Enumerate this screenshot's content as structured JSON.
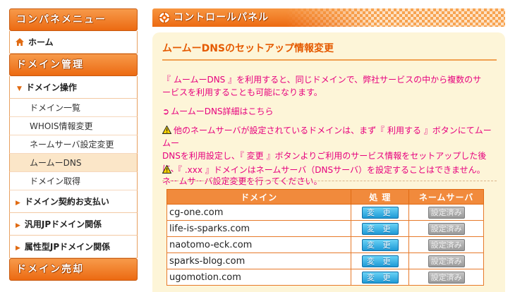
{
  "sidebar": {
    "menu_title": "コンパネメニュー",
    "home_label": "ホーム",
    "domain_mgmt_title": "ドメイン管理",
    "domain_ops_label": "ドメイン操作",
    "sub_items": [
      {
        "label": "ドメイン一覧"
      },
      {
        "label": "WHOIS情報変更"
      },
      {
        "label": "ネームサーバ設定変更"
      },
      {
        "label": "ムームーDNS"
      },
      {
        "label": "ドメイン取得"
      }
    ],
    "contract_label": "ドメイン契約お支払い",
    "jp_label": "汎用JPドメイン関係",
    "attr_jp_label": "属性型JPドメイン関係",
    "domain_sale_title": "ドメイン売却"
  },
  "main": {
    "header_title": "コントロールパネル",
    "panel_title": "ムームーDNSのセットアップ情報変更",
    "desc_line1": "『 ムームーDNS 』を利用すると、同じドメインで、弊社サービスの中から複数のサ",
    "desc_line2": "ービスを利用することも可能になります。",
    "detail_link": "ムームーDNS詳細はこちら",
    "warning1_line1": "他のネームサーバが設定されているドメインは、まず『 利用する 』ボタンにてムームー",
    "warning1_line2": "DNSを利用設定し、『 変更 』ボタンよりご利用のサービス情報をセットアップした後に、",
    "warning1_line3": "ネームサーバ設定変更を行ってください。",
    "warning2": "『 .xxx 』ドメインはネームサーバ（DNSサーバ）を設定することはできません。",
    "table": {
      "headers": {
        "domain": "ドメイン",
        "action": "処 理",
        "nameserver": "ネームサーバ"
      },
      "change_label": "変 更",
      "set_label": "設定済み",
      "rows": [
        {
          "domain": "cg-one.com"
        },
        {
          "domain": "life-is-sparks.com"
        },
        {
          "domain": "naotomo-eck.com"
        },
        {
          "domain": "sparks-blog.com"
        },
        {
          "domain": "ugomotion.com"
        }
      ]
    }
  },
  "colors": {
    "accent_orange": "#ec6a12",
    "panel_bg": "#fdf5d8",
    "warning_pink": "#e6007e",
    "button_blue": "#1f9ad6"
  },
  "icons": [
    "gear-icon",
    "home-icon",
    "warning-icon",
    "arrow-icon"
  ]
}
